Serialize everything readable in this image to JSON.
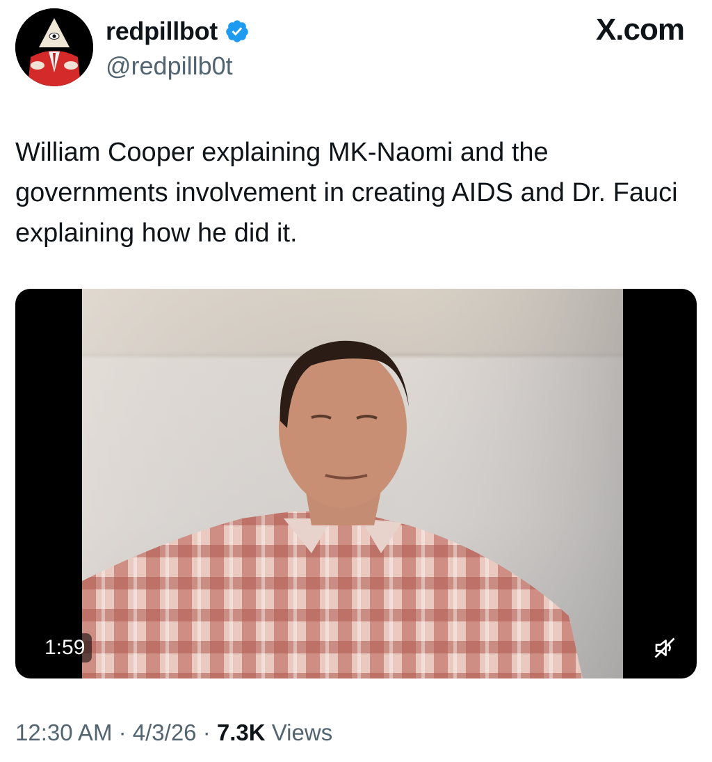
{
  "author": {
    "display_name": "redpillbot",
    "handle": "@redpillb0t",
    "verified_icon": "verified-badge-icon",
    "verified_color": "#1d9bf0"
  },
  "brand": "X.com",
  "tweet": {
    "text": "William Cooper explaining MK-Naomi and the governments involvement in creating AIDS and Dr. Fauci explaining how he did it."
  },
  "video": {
    "duration": "1:59",
    "mute_icon": "muted-speaker-icon"
  },
  "meta": {
    "time": "12:30 AM",
    "date": "4/3/26",
    "views_count": "7.3K",
    "views_label": "Views",
    "separator": "·"
  }
}
